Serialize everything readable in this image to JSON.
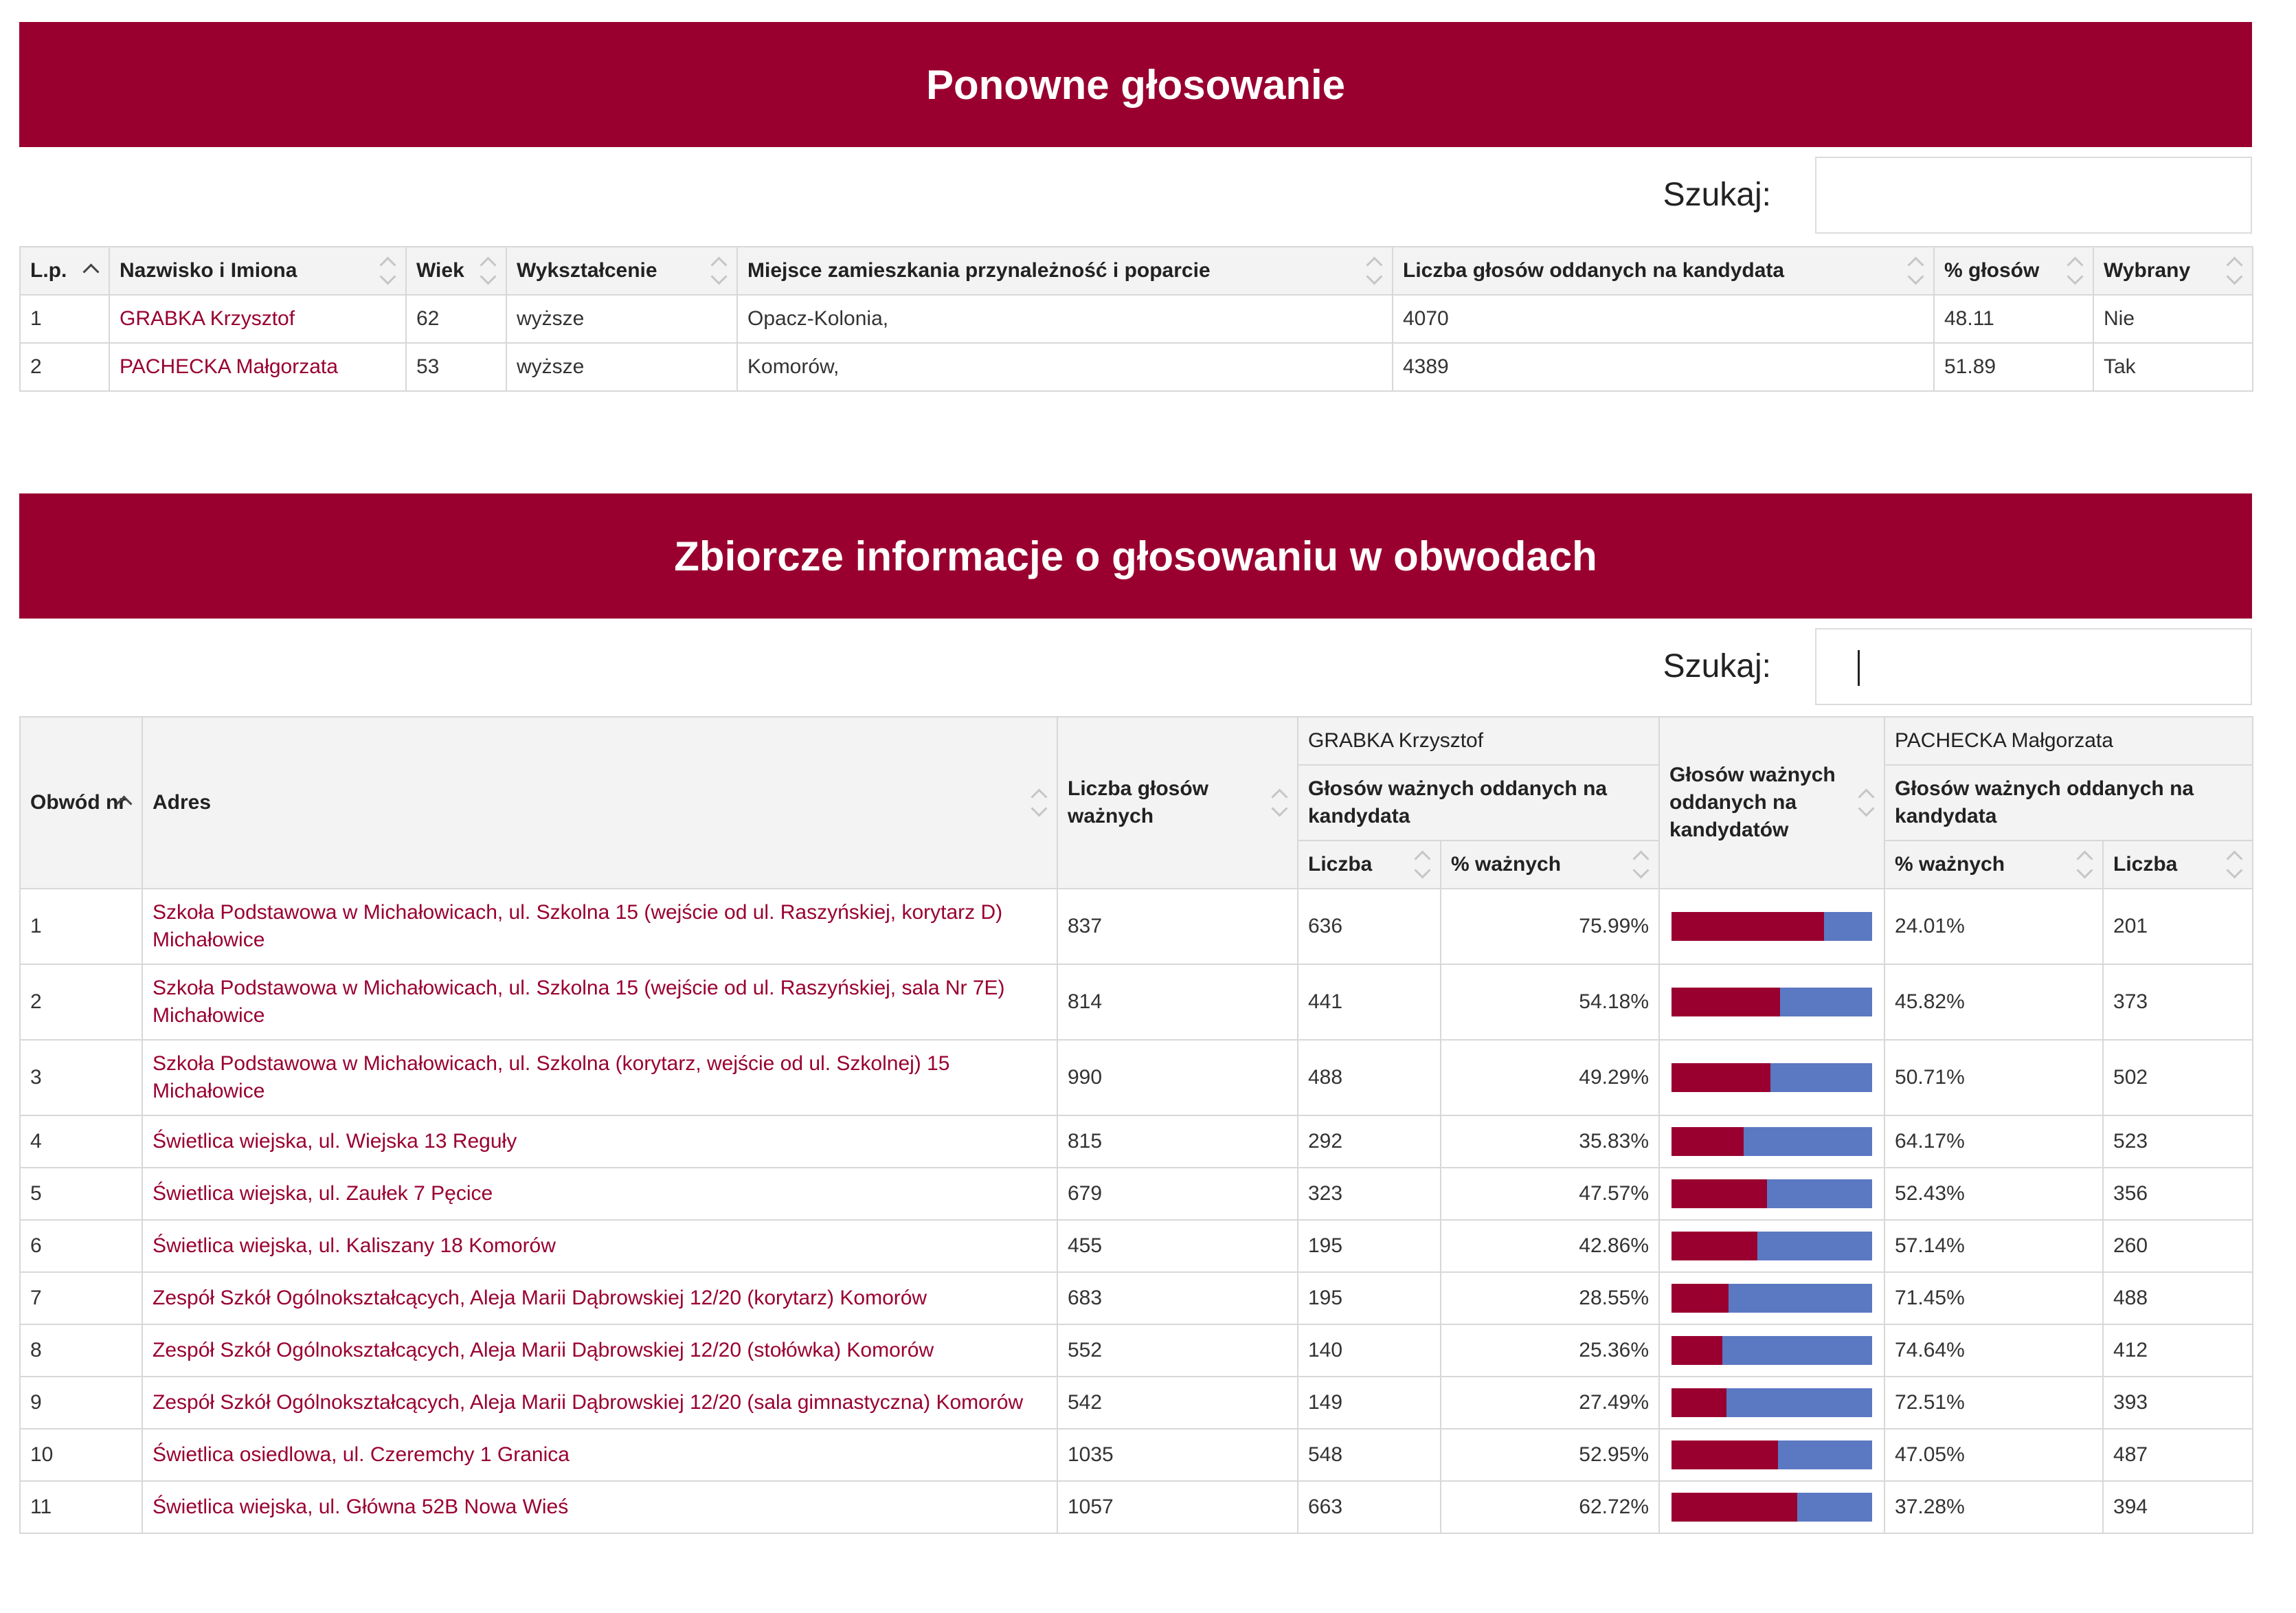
{
  "section1": {
    "title": "Ponowne głosowanie",
    "search_label": "Szukaj:",
    "columns": [
      "L.p.",
      "Nazwisko i Imiona",
      "Wiek",
      "Wykształcenie",
      "Miejsce zamieszkania przynależność i poparcie",
      "Liczba głosów oddanych na kandydata",
      "% głosów",
      "Wybrany"
    ],
    "rows": [
      {
        "lp": "1",
        "name": "GRABKA Krzysztof",
        "age": "62",
        "edu": "wyższe",
        "place": "Opacz-Kolonia,",
        "votes": "4070",
        "pct": "48.11",
        "elected": "Nie"
      },
      {
        "lp": "2",
        "name": "PACHECKA Małgorzata",
        "age": "53",
        "edu": "wyższe",
        "place": "Komorów,",
        "votes": "4389",
        "pct": "51.89",
        "elected": "Tak"
      }
    ]
  },
  "section2": {
    "title": "Zbiorcze informacje o głosowaniu w obwodach",
    "search_label": "Szukaj:",
    "headers": {
      "obwod": "Obwód nr",
      "adres": "Adres",
      "valid": "Liczba głosów ważnych",
      "cand1": "GRABKA Krzysztof",
      "cand2": "PACHECKA Małgorzata",
      "votes_for": "Głosów ważnych oddanych na kandydata",
      "chart": "Głosów ważnych oddanych na kandydatów",
      "liczba": "Liczba",
      "pct": "% ważnych"
    },
    "colors": {
      "cand1": "#990030",
      "cand2": "#5b78c2",
      "accent": "#990030"
    },
    "rows": [
      {
        "nr": "1",
        "adres": "Szkoła Podstawowa w Michałowicach, ul. Szkolna 15 (wejście od ul. Raszyńskiej, korytarz D) Michałowice",
        "valid": "837",
        "g_num": "636",
        "g_pct": "75.99%",
        "g_share": 75.99,
        "p_pct": "24.01%",
        "p_num": "201"
      },
      {
        "nr": "2",
        "adres": "Szkoła Podstawowa w Michałowicach, ul. Szkolna 15 (wejście od ul. Raszyńskiej, sala Nr 7E) Michałowice",
        "valid": "814",
        "g_num": "441",
        "g_pct": "54.18%",
        "g_share": 54.18,
        "p_pct": "45.82%",
        "p_num": "373"
      },
      {
        "nr": "3",
        "adres": "Szkoła Podstawowa w Michałowicach, ul. Szkolna (korytarz, wejście od ul. Szkolnej) 15 Michałowice",
        "valid": "990",
        "g_num": "488",
        "g_pct": "49.29%",
        "g_share": 49.29,
        "p_pct": "50.71%",
        "p_num": "502"
      },
      {
        "nr": "4",
        "adres": "Świetlica wiejska, ul. Wiejska 13 Reguły",
        "valid": "815",
        "g_num": "292",
        "g_pct": "35.83%",
        "g_share": 35.83,
        "p_pct": "64.17%",
        "p_num": "523"
      },
      {
        "nr": "5",
        "adres": "Świetlica wiejska, ul. Zaułek 7 Pęcice",
        "valid": "679",
        "g_num": "323",
        "g_pct": "47.57%",
        "g_share": 47.57,
        "p_pct": "52.43%",
        "p_num": "356"
      },
      {
        "nr": "6",
        "adres": "Świetlica wiejska, ul. Kaliszany 18 Komorów",
        "valid": "455",
        "g_num": "195",
        "g_pct": "42.86%",
        "g_share": 42.86,
        "p_pct": "57.14%",
        "p_num": "260"
      },
      {
        "nr": "7",
        "adres": "Zespół Szkół Ogólnokształcących, Aleja Marii Dąbrowskiej 12/20 (korytarz) Komorów",
        "valid": "683",
        "g_num": "195",
        "g_pct": "28.55%",
        "g_share": 28.55,
        "p_pct": "71.45%",
        "p_num": "488"
      },
      {
        "nr": "8",
        "adres": "Zespół Szkół Ogólnokształcących, Aleja Marii Dąbrowskiej 12/20 (stołówka) Komorów",
        "valid": "552",
        "g_num": "140",
        "g_pct": "25.36%",
        "g_share": 25.36,
        "p_pct": "74.64%",
        "p_num": "412"
      },
      {
        "nr": "9",
        "adres": "Zespół Szkół Ogólnokształcących, Aleja Marii Dąbrowskiej 12/20 (sala gimnastyczna) Komorów",
        "valid": "542",
        "g_num": "149",
        "g_pct": "27.49%",
        "g_share": 27.49,
        "p_pct": "72.51%",
        "p_num": "393"
      },
      {
        "nr": "10",
        "adres": "Świetlica osiedlowa, ul. Czeremchy 1 Granica",
        "valid": "1035",
        "g_num": "548",
        "g_pct": "52.95%",
        "g_share": 52.95,
        "p_pct": "47.05%",
        "p_num": "487"
      },
      {
        "nr": "11",
        "adres": "Świetlica wiejska, ul. Główna 52B Nowa Wieś",
        "valid": "1057",
        "g_num": "663",
        "g_pct": "62.72%",
        "g_share": 62.72,
        "p_pct": "37.28%",
        "p_num": "394"
      }
    ]
  }
}
